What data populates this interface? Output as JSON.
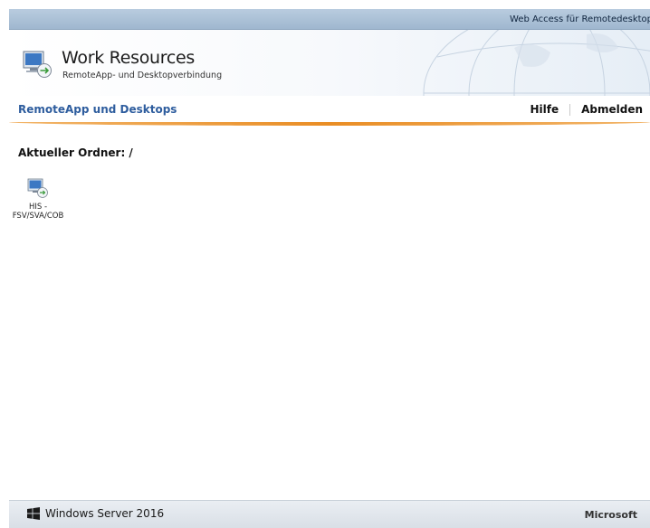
{
  "topbar": {
    "label": "Web Access für Remotedesktop",
    "icon": "remote-desktop-icon"
  },
  "header": {
    "title": "Work Resources",
    "subtitle": "RemoteApp- und Desktopverbindung",
    "icon": "remote-app-logo-icon"
  },
  "nav": {
    "title": "RemoteApp und Desktops",
    "links": {
      "help": "Hilfe",
      "logout": "Abmelden"
    }
  },
  "content": {
    "folder_label": "Aktueller Ordner: /",
    "apps": [
      {
        "name": "HIS -\nFSV/SVA/COB",
        "icon": "remote-desktop-app-icon"
      }
    ]
  },
  "footer": {
    "left": "Windows Server 2016",
    "right": "Microsoft"
  },
  "colors": {
    "accent_orange": "#e98d24",
    "nav_title_blue": "#2e5d9e",
    "topbar_blue": "#b9ccdf"
  }
}
